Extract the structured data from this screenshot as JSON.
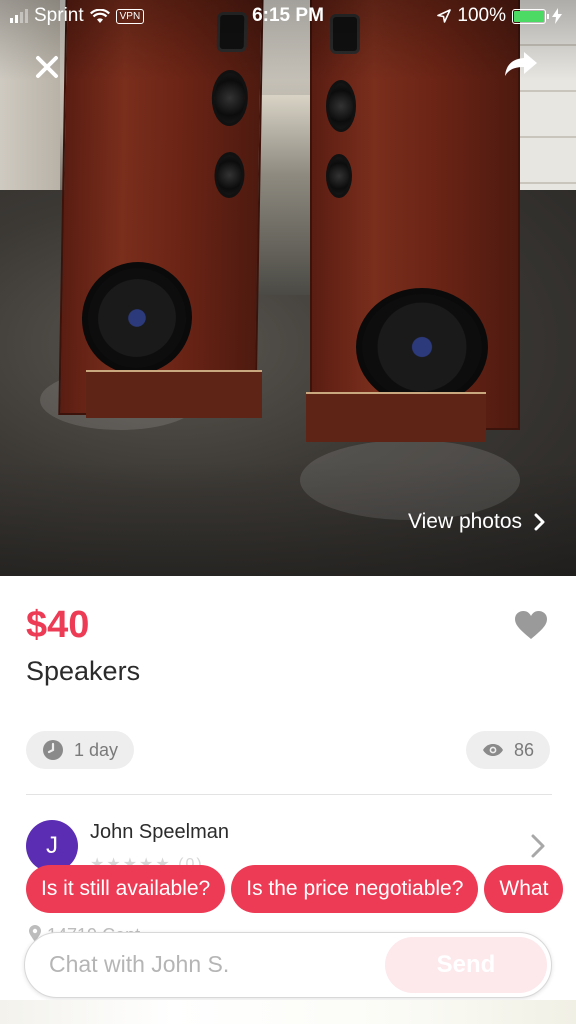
{
  "status_bar": {
    "carrier": "Sprint",
    "vpn": "VPN",
    "time": "6:15 PM",
    "battery_text": "100%",
    "battery_level": 1.0,
    "battery_color": "#4cd964"
  },
  "hero": {
    "close_icon": "close-icon",
    "share_icon": "share-arrow-icon",
    "view_photos_label": "View photos"
  },
  "listing": {
    "price": "$40",
    "title": "Speakers",
    "posted": "1 day",
    "views": "86",
    "price_color": "#ee3b55"
  },
  "seller": {
    "initial": "J",
    "name": "John Speelman",
    "rating_count": "(0)",
    "avatar_color": "#5b2db3"
  },
  "location": {
    "text": "14719 Cent"
  },
  "quick_replies": [
    "Is it still available?",
    "Is the price negotiable?",
    "What"
  ],
  "chat": {
    "placeholder": "Chat with John S.",
    "send_label": "Send"
  }
}
